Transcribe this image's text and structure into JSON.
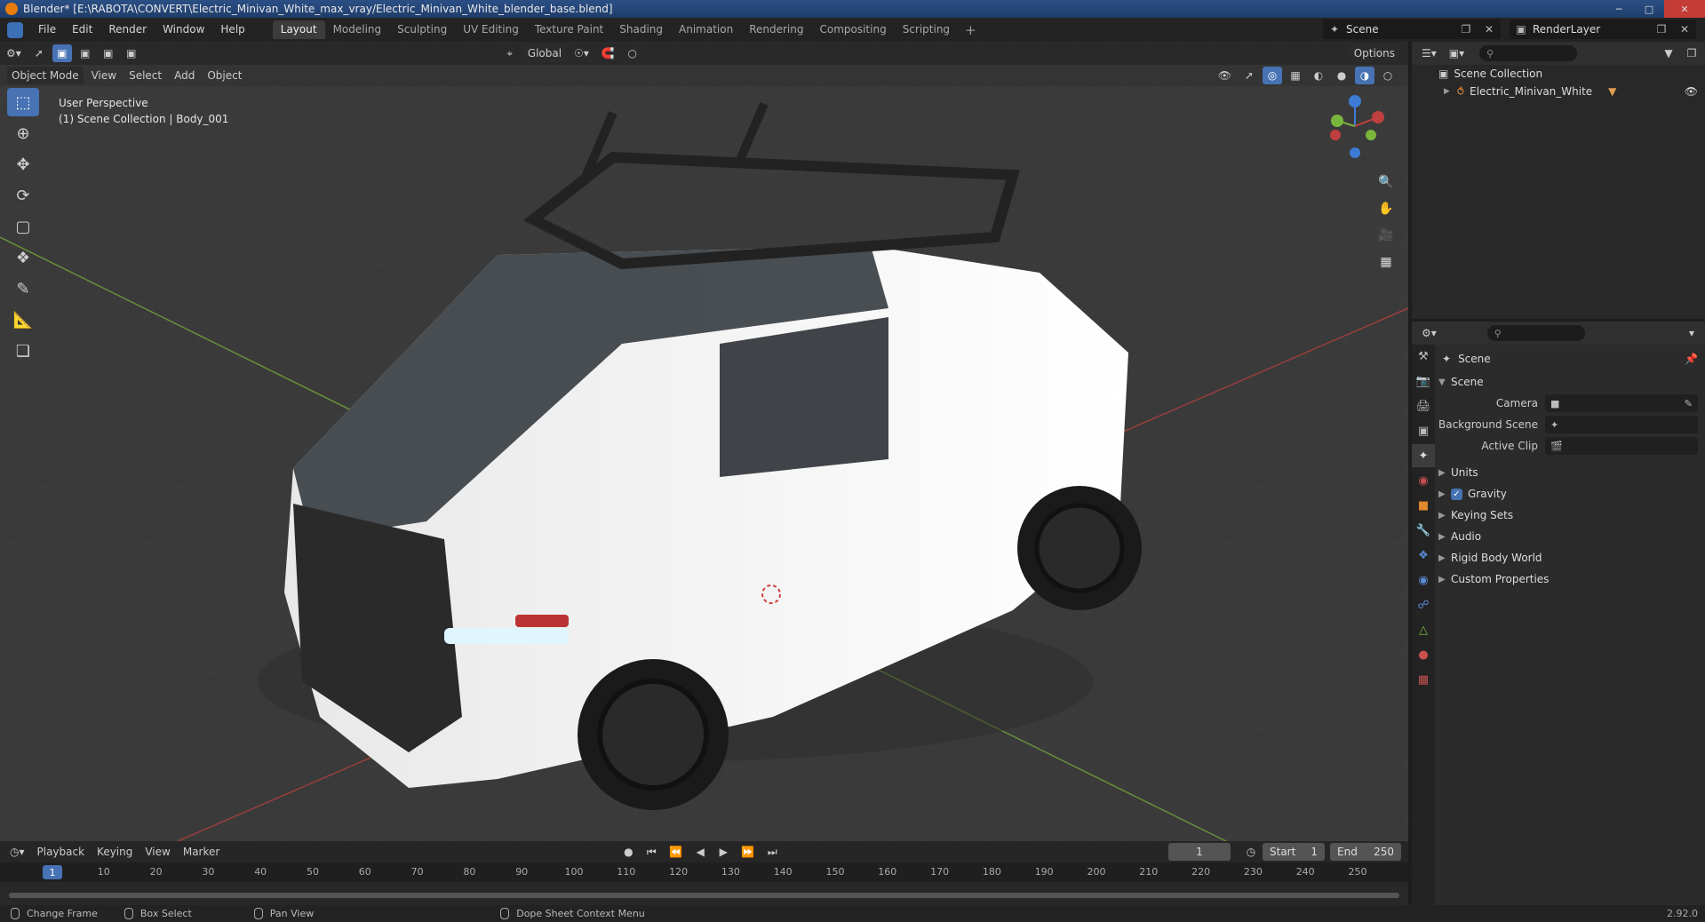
{
  "window": {
    "title": "Blender* [E:\\RABOTA\\CONVERT\\Electric_Minivan_White_max_vray/Electric_Minivan_White_blender_base.blend]"
  },
  "menu": [
    "File",
    "Edit",
    "Render",
    "Window",
    "Help"
  ],
  "workspaces": [
    {
      "label": "Layout",
      "active": true
    },
    {
      "label": "Modeling",
      "active": false
    },
    {
      "label": "Sculpting",
      "active": false
    },
    {
      "label": "UV Editing",
      "active": false
    },
    {
      "label": "Texture Paint",
      "active": false
    },
    {
      "label": "Shading",
      "active": false
    },
    {
      "label": "Animation",
      "active": false
    },
    {
      "label": "Rendering",
      "active": false
    },
    {
      "label": "Compositing",
      "active": false
    },
    {
      "label": "Scripting",
      "active": false
    }
  ],
  "scene_selector": "Scene",
  "render_layer": "RenderLayer",
  "viewport": {
    "transform_orientation": "Global",
    "options_label": "Options",
    "mode": "Object Mode",
    "menu": [
      "View",
      "Select",
      "Add",
      "Object"
    ],
    "info_line1": "User Perspective",
    "info_line2": "(1) Scene Collection | Body_001"
  },
  "timeline": {
    "menu": [
      "Playback",
      "Keying",
      "View",
      "Marker"
    ],
    "current_frame": "1",
    "start_label": "Start",
    "start": "1",
    "end_label": "End",
    "end": "250",
    "ticks": [
      "1",
      "10",
      "20",
      "30",
      "40",
      "50",
      "60",
      "70",
      "80",
      "90",
      "100",
      "110",
      "120",
      "130",
      "140",
      "150",
      "160",
      "170",
      "180",
      "190",
      "200",
      "210",
      "220",
      "230",
      "240",
      "250"
    ]
  },
  "statusbar": {
    "items": [
      "Change Frame",
      "Box Select",
      "Pan View",
      "Dope Sheet Context Menu"
    ],
    "version": "2.92.0"
  },
  "outliner": {
    "root": "Scene Collection",
    "items": [
      "Electric_Minivan_White"
    ]
  },
  "properties": {
    "context": "Scene",
    "panel": "Scene",
    "fields": [
      {
        "label": "Camera",
        "value": ""
      },
      {
        "label": "Background Scene",
        "value": ""
      },
      {
        "label": "Active Clip",
        "value": ""
      }
    ],
    "sections": [
      "Units",
      "Gravity",
      "Keying Sets",
      "Audio",
      "Rigid Body World",
      "Custom Properties"
    ]
  },
  "colors": {
    "accent": "#4772b3",
    "x_axis": "#c0403f",
    "y_axis": "#7ab53c",
    "z_axis": "#3d7bd6"
  }
}
